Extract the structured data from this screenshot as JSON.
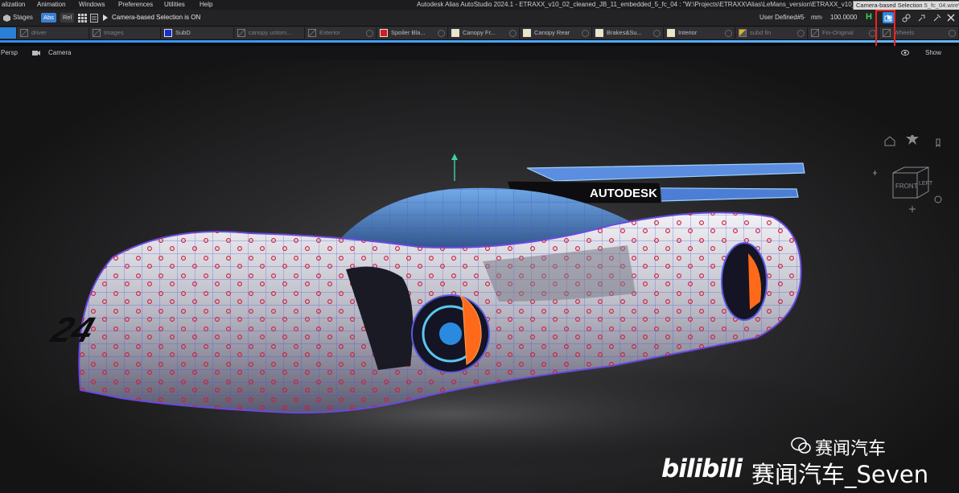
{
  "menubar": {
    "items": [
      "alization",
      "Animation",
      "Windows",
      "Preferences",
      "Utilities",
      "Help"
    ],
    "window_title": "Autodesk Alias AutoStudio 2024.1   - ETRAXX_v10_02_cleaned_JB_11_embedded_5_fc_04 : \"W:\\Projects\\ETRAXX\\Alias\\LeMans_version\\ETRAXX_v10_02_c",
    "title_suffix": "5_fc_04.wire\"",
    "tooltip": "Camera-based Selection"
  },
  "toolbar": {
    "stages_label": "Stages",
    "abs_label": "Abs",
    "rel_label": "Rel",
    "status_message": "Camera-based Selection is ON",
    "user_defined": "User Defined#5",
    "unit_sep": "·",
    "units": "mm",
    "tolerance": "100.0000",
    "h_label": "H"
  },
  "layers": [
    {
      "label": "",
      "color": "#2a7fd6",
      "dim": false
    },
    {
      "label": "driver",
      "color": "none",
      "dim": true
    },
    {
      "label": "Images",
      "color": "none",
      "dim": true
    },
    {
      "label": "SubD",
      "color": "#1530c8",
      "dim": false
    },
    {
      "label": "canopy untom...",
      "color": "none",
      "dim": true
    },
    {
      "label": "Exterior",
      "color": "none",
      "dim": true
    },
    {
      "label": "Spoiler Bla...",
      "color": "#d81b1b",
      "dim": false
    },
    {
      "label": "Canopy Fr...",
      "color": "#efe6c4",
      "dim": false
    },
    {
      "label": "Canopy Rear",
      "color": "#efe6c4",
      "dim": false
    },
    {
      "label": "Brakes&Su...",
      "color": "#efe6c4",
      "dim": false
    },
    {
      "label": "Interior",
      "color": "#efe6c4",
      "dim": false
    },
    {
      "label": "subd fin",
      "color": "#e0b020",
      "dim": true
    },
    {
      "label": "Fin-Original",
      "color": "none",
      "dim": true
    },
    {
      "label": "Wheels",
      "color": "none",
      "dim": true
    }
  ],
  "viewport": {
    "view_name": "Persp",
    "camera_label": "Camera",
    "show_label": "Show",
    "cube_front": "FRONT",
    "cube_left": "LEFT",
    "car_logo": "AUTODESK",
    "car_number": "24"
  },
  "watermark": {
    "channel": "赛闻汽车",
    "bilibili": "bilibili",
    "handle": "赛闻汽车_Seven"
  },
  "colors": {
    "accent": "#2d8ef0",
    "highlight": "#e22222",
    "h_green": "#3bd45a"
  }
}
